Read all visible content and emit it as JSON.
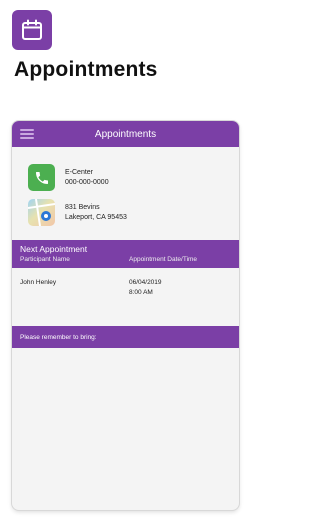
{
  "page": {
    "title": "Appointments",
    "icon": "calendar-icon",
    "accent": "#7b3fa6"
  },
  "phone": {
    "header_title": "Appointments",
    "menu_icon": "hamburger-icon",
    "contact": {
      "name": "E-Center",
      "phone": "000-000-0000",
      "address_line1": "831 Bevins",
      "address_line2": "Lakeport, CA 95453"
    },
    "next_appointment": {
      "title": "Next Appointment",
      "col1": "Participant Name",
      "col2": "Appointment Date/Time",
      "participant": "John Henley",
      "date": "06/04/2019",
      "time": "8:00 AM"
    },
    "remember_label": "Please remember to bring:"
  }
}
